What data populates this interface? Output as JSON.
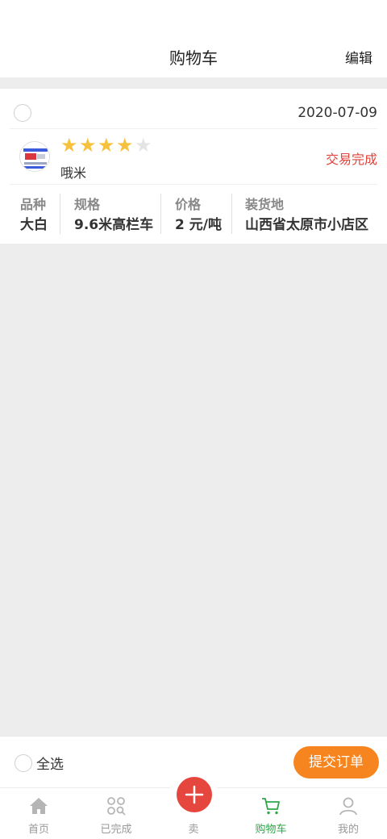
{
  "header": {
    "title": "购物车",
    "edit_label": "编辑"
  },
  "order": {
    "date": "2020-07-09",
    "rating": 4,
    "rating_max": 5,
    "seller_name": "哦米",
    "status": "交易完成",
    "fields": [
      {
        "label": "品种",
        "value": "大白"
      },
      {
        "label": "规格",
        "value": "9.6米高栏车"
      },
      {
        "label": "价格",
        "value": "2 元/吨"
      },
      {
        "label": "装货地",
        "value": "山西省太原市小店区"
      }
    ]
  },
  "footer": {
    "select_all_label": "全选",
    "submit_label": "提交订单"
  },
  "tabs": [
    {
      "label": "首页",
      "icon": "home-icon",
      "active": false
    },
    {
      "label": "已完成",
      "icon": "grid-search-icon",
      "active": false
    },
    {
      "label": "卖",
      "icon": "plus-icon",
      "active": false
    },
    {
      "label": "购物车",
      "icon": "cart-icon",
      "active": true
    },
    {
      "label": "我的",
      "icon": "user-icon",
      "active": false
    }
  ],
  "colors": {
    "accent_green": "#2ea84a",
    "status_red": "#e0433b",
    "star_gold": "#f6c23e",
    "submit_orange": "#f6851f",
    "fab_red": "#e5473e"
  }
}
